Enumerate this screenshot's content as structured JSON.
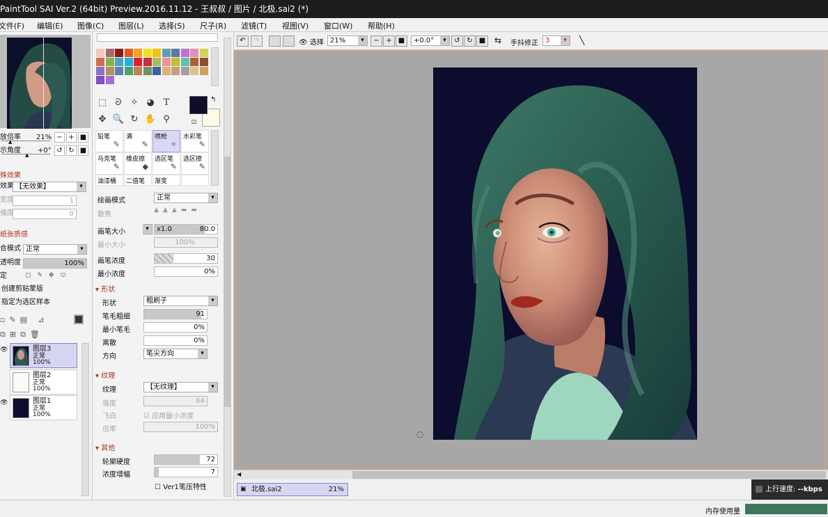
{
  "window": {
    "title": "PaintTool SAI Ver.2 (64bit) Preview.2016.11.12 - 王叔叔 / 图片 / 北极.sai2 (*)"
  },
  "menu": [
    "文件(F)",
    "编辑(E)",
    "图像(C)",
    "图层(L)",
    "选择(S)",
    "尺子(R)",
    "滤镜(T)",
    "视图(V)",
    "窗口(W)",
    "帮助(H)"
  ],
  "navigator": {
    "zoom_label": "放倍率",
    "zoom_value": "21%",
    "angle_label": "示角度",
    "angle_value": "+0°"
  },
  "special_effects": {
    "title": "殊效果",
    "effect_label": "效果",
    "effect_value": "【无效果】",
    "width_label": "宽度",
    "width_value": "1",
    "strength_label": "强度",
    "strength_value": "0"
  },
  "paper_texture": {
    "title": "纸张质感"
  },
  "blend": {
    "mode_label": "合模式",
    "mode_value": "正常",
    "opacity_label": "透明度",
    "opacity_value": "100%",
    "opacity_level": 1.0,
    "lock_label": "定"
  },
  "layer_options": {
    "clip": "创建剪贴蒙版",
    "sample": "指定为选区样本"
  },
  "layers": [
    {
      "name": "图层3",
      "mode": "正常",
      "opacity": "100%",
      "selected": true
    },
    {
      "name": "图层2",
      "mode": "正常",
      "opacity": "100%",
      "selected": false
    },
    {
      "name": "图层1",
      "mode": "正常",
      "opacity": "100%",
      "selected": false
    }
  ],
  "colors": {
    "primary": "#0d0d2b",
    "secondary": "#fbfbe6",
    "palette": [
      "#f3c9c0",
      "#a66a70",
      "#8b1a1a",
      "#e05a20",
      "#f5a020",
      "#f2e020",
      "#f5c010",
      "#5aa0b0",
      "#5a7aa0",
      "#c070d0",
      "#e090b0",
      "#d8d050",
      "#d07050",
      "#8ab050",
      "#50a0c0",
      "#20b0e0",
      "#e02030",
      "#c03040",
      "#a0c060",
      "#f090a0",
      "#c0c030",
      "#60c0b0",
      "#b06030",
      "#8a5030",
      "#9070c0",
      "#b09060",
      "#6080b0",
      "#50a070",
      "#c08050",
      "#709060",
      "#4060a0",
      "#e0b070",
      "#c0a080",
      "#a0a0a0",
      "#e0c090",
      "#d0a060",
      "#8050c0",
      "#a070d0"
    ]
  },
  "tools": [
    "select-rect",
    "lasso",
    "magic-wand",
    "bucket-select",
    "text",
    "move",
    "zoom",
    "rotate",
    "hand",
    "eyedropper"
  ],
  "brushes": [
    {
      "name": "铅笔",
      "glyph": "✎",
      "selected": false
    },
    {
      "name": "满",
      "glyph": "✎",
      "selected": false
    },
    {
      "name": "喷枪",
      "glyph": "✧",
      "selected": true
    },
    {
      "name": "水彩笔",
      "glyph": "✎",
      "selected": false
    },
    {
      "name": "马克笔",
      "glyph": "✎",
      "selected": false
    },
    {
      "name": "橡皮擦",
      "glyph": "◆",
      "selected": false
    },
    {
      "name": "选区笔",
      "glyph": "✎",
      "selected": false
    },
    {
      "name": "选区擦",
      "glyph": "✎",
      "selected": false
    },
    {
      "name": "油漆桶",
      "glyph": "",
      "selected": false
    },
    {
      "name": "二值笔",
      "glyph": "",
      "selected": false
    },
    {
      "name": "渐变",
      "glyph": "",
      "selected": false
    },
    {
      "name": "",
      "glyph": "",
      "selected": false
    }
  ],
  "brush_settings": {
    "draw_mode_label": "绘画模式",
    "draw_mode_value": "正常",
    "scatter_label": "散焦",
    "size_label": "画笔大小",
    "size_mult": "x1.0",
    "size_value": "80.0",
    "size_level": 0.8,
    "min_size_label": "最小大小",
    "min_size_value": "100%",
    "density_label": "画笔浓度",
    "density_value": "30",
    "density_level": 0.3,
    "min_density_label": "最小浓度",
    "min_density_value": "0%",
    "shape_section": "形状",
    "shape_label": "形状",
    "shape_value": "粗刷子",
    "bristle_label": "笔毛粗细",
    "bristle_value": "91",
    "bristle_level": 0.91,
    "min_bristle_label": "最小笔毛",
    "min_bristle_value": "0%",
    "scatter2_label": "离散",
    "scatter2_value": "0%",
    "direction_label": "方向",
    "direction_value": "笔尖方向",
    "texture_section": "纹理",
    "texture_label": "纹理",
    "texture_value": "【无纹理】",
    "tex_strength_label": "强度",
    "tex_strength_value": "64",
    "fly_label": "飞白",
    "fly_option": "应用最小浓度",
    "scale_label": "倍率",
    "scale_value": "100%",
    "other_section": "其他",
    "hardness_label": "轮廓硬度",
    "hardness_value": "72",
    "hardness_level": 0.72,
    "amp_label": "浓度增幅",
    "amp_value": "7",
    "amp_level": 0.07,
    "ver1_label": "Ver1笔压特性"
  },
  "toolbar": {
    "select_label": "选择",
    "zoom_value": "21%",
    "angle_value": "+0.0°",
    "stabilizer_label": "手抖修正",
    "stabilizer_value": "3"
  },
  "file_tab": {
    "name": "北极.sai2",
    "zoom": "21%"
  },
  "status": {
    "upload_label": "上行速度:",
    "upload_value": "--kbps",
    "memory_label": "内存使用量"
  }
}
